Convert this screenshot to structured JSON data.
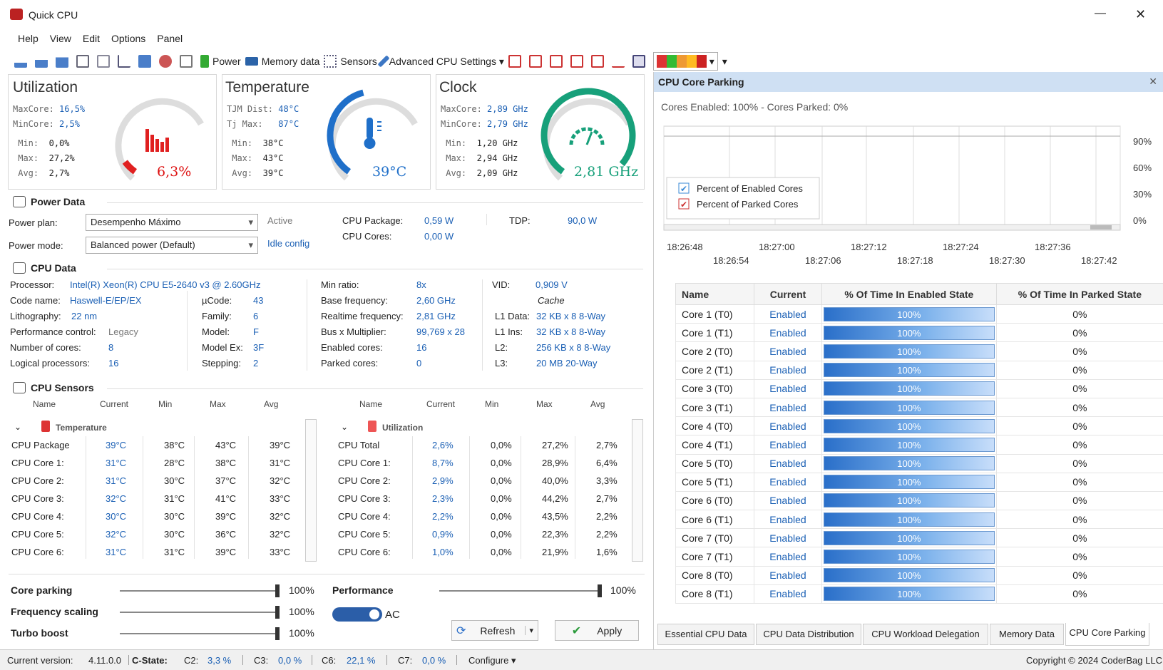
{
  "window": {
    "title": "Quick CPU",
    "minimize": "—",
    "close": "✕"
  },
  "menu": [
    "Help",
    "View",
    "Edit",
    "Options",
    "Panel"
  ],
  "toolbar": {
    "power": "Power",
    "memory": "Memory data",
    "sensors": "Sensors",
    "advanced": "Advanced CPU Settings"
  },
  "utilization": {
    "title": "Utilization",
    "maxcore_l": "MaxCore:",
    "maxcore": "16,5%",
    "mincore_l": "MinCore:",
    "mincore": "2,5%",
    "min_l": "Min:",
    "min": "0,0%",
    "max_l": "Max:",
    "max": "27,2%",
    "avg_l": "Avg:",
    "avg": "2,7%",
    "value": "6,3%",
    "level": 0.063
  },
  "temperature": {
    "title": "Temperature",
    "tjm_l": "TJM Dist:",
    "tjm": "48°C",
    "tj_l": "Tj Max:",
    "tj": "87°C",
    "min_l": "Min:",
    "min": "38°C",
    "max_l": "Max:",
    "max": "43°C",
    "avg_l": "Avg:",
    "avg": "39°C",
    "value": "39°C",
    "level": 0.45
  },
  "clock": {
    "title": "Clock",
    "maxcore_l": "MaxCore:",
    "maxcore": "2,89 GHz",
    "mincore_l": "MinCore:",
    "mincore": "2,79 GHz",
    "min_l": "Min:",
    "min": "1,20 GHz",
    "max_l": "Max:",
    "max": "2,94 GHz",
    "avg_l": "Avg:",
    "avg": "2,09 GHz",
    "value": "2,81 GHz",
    "level": 0.95
  },
  "power": {
    "header": "Power Data",
    "plan_l": "Power plan:",
    "plan": "Desempenho Máximo",
    "mode_l": "Power mode:",
    "mode": "Balanced power (Default)",
    "active": "Active",
    "idle": "Idle config",
    "pkg_l": "CPU Package:",
    "pkg": "0,59 W",
    "cores_l": "CPU Cores:",
    "cores": "0,00 W",
    "tdp_l": "TDP:",
    "tdp": "90,0 W"
  },
  "cpu": {
    "header": "CPU Data",
    "processor_l": "Processor:",
    "processor": "Intel(R) Xeon(R) CPU E5-2640 v3 @ 2.60GHz",
    "code_l": "Code name:",
    "code": "Haswell-E/EP/EX",
    "litho_l": "Lithography:",
    "litho": "22 nm",
    "perf_l": "Performance control:",
    "perf": "Legacy",
    "ncores_l": "Number of cores:",
    "ncores": "8",
    "logical_l": "Logical processors:",
    "logical": "16",
    "ucode_l": "µCode:",
    "ucode": "43",
    "family_l": "Family:",
    "family": "6",
    "model_l": "Model:",
    "model": "F",
    "modelex_l": "Model Ex:",
    "modelex": "3F",
    "stepping_l": "Stepping:",
    "stepping": "2",
    "minratio_l": "Min ratio:",
    "minratio": "8x",
    "basefreq_l": "Base frequency:",
    "basefreq": "2,60 GHz",
    "rtfreq_l": "Realtime frequency:",
    "rtfreq": "2,81 GHz",
    "bus_l": "Bus x Multiplier:",
    "bus": "99,769 x 28",
    "enabled_l": "Enabled cores:",
    "enabled": "16",
    "parked_l": "Parked cores:",
    "parked": "0",
    "vid_l": "VID:",
    "vid": "0,909 V",
    "cache": "Cache",
    "l1d_l": "L1 Data:",
    "l1d": "32 KB x 8  8-Way",
    "l1i_l": "L1 Ins:",
    "l1i": "32 KB x 8  8-Way",
    "l2_l": "L2:",
    "l2": "256 KB x 8  8-Way",
    "l3_l": "L3:",
    "l3": "20 MB  20-Way"
  },
  "sensors": {
    "header": "CPU Sensors",
    "cols": [
      "Name",
      "Current",
      "Min",
      "Max",
      "Avg"
    ],
    "temp_group": "Temperature",
    "util_group": "Utilization",
    "temp": [
      [
        "CPU Package",
        "39°C",
        "38°C",
        "43°C",
        "39°C"
      ],
      [
        "CPU Core 1:",
        "31°C",
        "28°C",
        "38°C",
        "31°C"
      ],
      [
        "CPU Core 2:",
        "31°C",
        "30°C",
        "37°C",
        "32°C"
      ],
      [
        "CPU Core 3:",
        "32°C",
        "31°C",
        "41°C",
        "33°C"
      ],
      [
        "CPU Core 4:",
        "30°C",
        "30°C",
        "39°C",
        "32°C"
      ],
      [
        "CPU Core 5:",
        "32°C",
        "30°C",
        "36°C",
        "32°C"
      ],
      [
        "CPU Core 6:",
        "31°C",
        "31°C",
        "39°C",
        "33°C"
      ]
    ],
    "util": [
      [
        "CPU Total",
        "2,6%",
        "0,0%",
        "27,2%",
        "2,7%"
      ],
      [
        "CPU Core 1:",
        "8,7%",
        "0,0%",
        "28,9%",
        "6,4%"
      ],
      [
        "CPU Core 2:",
        "2,9%",
        "0,0%",
        "40,0%",
        "3,3%"
      ],
      [
        "CPU Core 3:",
        "2,3%",
        "0,0%",
        "44,2%",
        "2,7%"
      ],
      [
        "CPU Core 4:",
        "2,2%",
        "0,0%",
        "43,5%",
        "2,2%"
      ],
      [
        "CPU Core 5:",
        "0,9%",
        "0,0%",
        "22,3%",
        "2,2%"
      ],
      [
        "CPU Core 6:",
        "1,0%",
        "0,0%",
        "21,9%",
        "1,6%"
      ]
    ]
  },
  "controls": {
    "parking_l": "Core parking",
    "parking": "100%",
    "freq_l": "Frequency scaling",
    "freq": "100%",
    "turbo_l": "Turbo boost",
    "turbo": "100%",
    "perf_l": "Performance",
    "perf": "100%",
    "ac": "AC",
    "refresh": "Refresh",
    "apply": "Apply"
  },
  "parking": {
    "title": "CPU Core Parking",
    "summary": "Cores Enabled: 100% - Cores Parked: 0%",
    "yticks": [
      "90%",
      "60%",
      "30%",
      "0%"
    ],
    "xticks_top": [
      "18:26:48",
      "18:27:00",
      "18:27:12",
      "18:27:24",
      "18:27:36"
    ],
    "xticks_bottom": [
      "18:26:54",
      "18:27:06",
      "18:27:18",
      "18:27:30",
      "18:27:42"
    ],
    "legend": [
      "Percent of Enabled Cores",
      "Percent of Parked Cores"
    ],
    "cols": [
      "Name",
      "Current",
      "% Of Time In Enabled State",
      "% Of Time In Parked State"
    ],
    "rows": [
      [
        "Core 1 (T0)",
        "Enabled",
        "100%",
        "0%"
      ],
      [
        "Core 1 (T1)",
        "Enabled",
        "100%",
        "0%"
      ],
      [
        "Core 2 (T0)",
        "Enabled",
        "100%",
        "0%"
      ],
      [
        "Core 2 (T1)",
        "Enabled",
        "100%",
        "0%"
      ],
      [
        "Core 3 (T0)",
        "Enabled",
        "100%",
        "0%"
      ],
      [
        "Core 3 (T1)",
        "Enabled",
        "100%",
        "0%"
      ],
      [
        "Core 4 (T0)",
        "Enabled",
        "100%",
        "0%"
      ],
      [
        "Core 4 (T1)",
        "Enabled",
        "100%",
        "0%"
      ],
      [
        "Core 5 (T0)",
        "Enabled",
        "100%",
        "0%"
      ],
      [
        "Core 5 (T1)",
        "Enabled",
        "100%",
        "0%"
      ],
      [
        "Core 6 (T0)",
        "Enabled",
        "100%",
        "0%"
      ],
      [
        "Core 6 (T1)",
        "Enabled",
        "100%",
        "0%"
      ],
      [
        "Core 7 (T0)",
        "Enabled",
        "100%",
        "0%"
      ],
      [
        "Core 7 (T1)",
        "Enabled",
        "100%",
        "0%"
      ],
      [
        "Core 8 (T0)",
        "Enabled",
        "100%",
        "0%"
      ],
      [
        "Core 8 (T1)",
        "Enabled",
        "100%",
        "0%"
      ]
    ]
  },
  "tabs": [
    "Essential CPU Data",
    "CPU Data Distribution",
    "CPU Workload Delegation",
    "Memory Data",
    "CPU Core Parking"
  ],
  "status": {
    "version_l": "Current version:",
    "version": "4.11.0.0",
    "cstate": "C-State:",
    "c2_l": "C2:",
    "c2": "3,3 %",
    "c3_l": "C3:",
    "c3": "0,0 %",
    "c6_l": "C6:",
    "c6": "22,1 %",
    "c7_l": "C7:",
    "c7": "0,0 %",
    "configure": "Configure ▾",
    "copyright": "Copyright © 2024 CoderBag LLC"
  },
  "colors": {
    "accent": "#1a5fb4",
    "util_arc": "#e02020",
    "temp_arc": "#1f6fc9",
    "clock_arc": "#17a07a"
  }
}
